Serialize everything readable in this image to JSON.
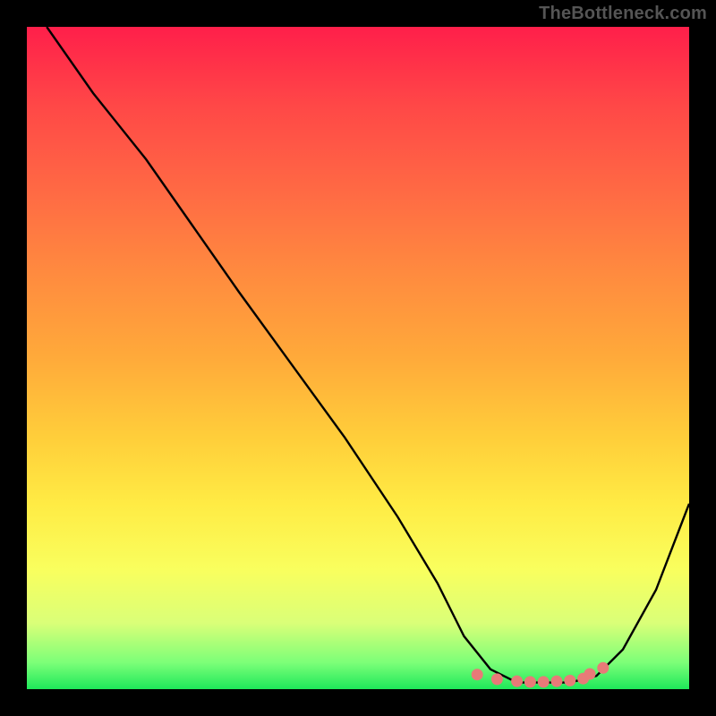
{
  "watermark": "TheBottleneck.com",
  "colors": {
    "background": "#000000",
    "curve": "#000000",
    "dots": "#e87a78",
    "gradient_top": "#ff1f4a",
    "gradient_bottom": "#1ee85a"
  },
  "chart_data": {
    "type": "line",
    "title": "",
    "xlabel": "",
    "ylabel": "",
    "xlim": [
      0,
      100
    ],
    "ylim": [
      0,
      100
    ],
    "series": [
      {
        "name": "bottleneck-curve",
        "x": [
          3,
          10,
          18,
          25,
          32,
          40,
          48,
          56,
          62,
          66,
          70,
          74,
          78,
          82,
          86,
          90,
          95,
          100
        ],
        "values": [
          100,
          90,
          80,
          70,
          60,
          49,
          38,
          26,
          16,
          8,
          3,
          1,
          1,
          1,
          2,
          6,
          15,
          28
        ]
      }
    ],
    "markers": {
      "name": "valley-dots",
      "x": [
        68,
        71,
        74,
        76,
        78,
        80,
        82,
        84,
        85,
        87
      ],
      "values": [
        2.2,
        1.5,
        1.2,
        1.1,
        1.1,
        1.2,
        1.3,
        1.6,
        2.3,
        3.2
      ]
    }
  }
}
